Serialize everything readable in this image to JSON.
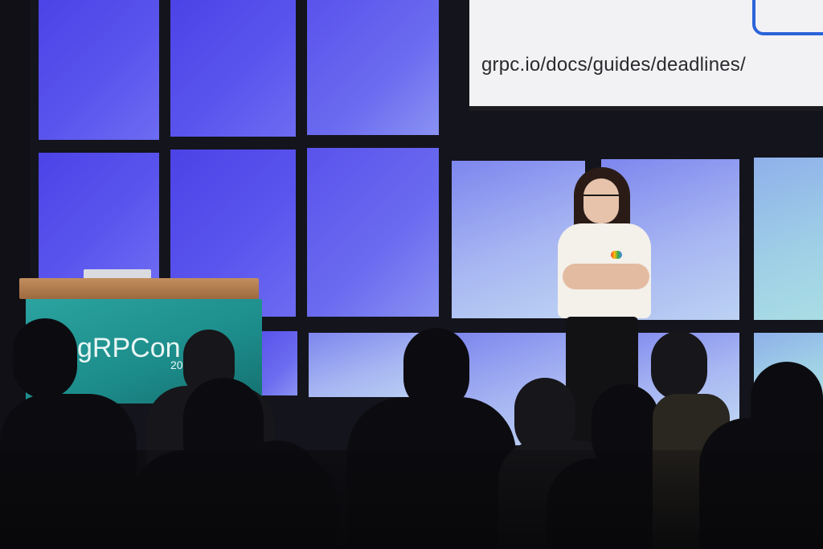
{
  "slide": {
    "url_text": "grpc.io/docs/guides/deadlines/"
  },
  "podium": {
    "logo_text": "gRPCon",
    "year_fragment": "20"
  },
  "colors": {
    "wall_blue": "#5a54ee",
    "wall_teal": "#9fd0e6",
    "podium_teal": "#1c8c8a",
    "slide_accent": "#2b63d9"
  }
}
